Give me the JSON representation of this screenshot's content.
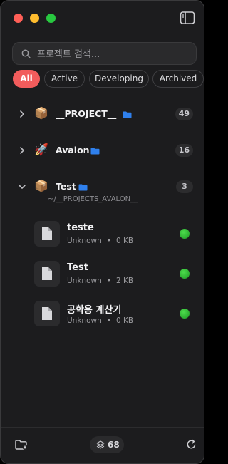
{
  "search": {
    "placeholder": "프로젝트 검색..."
  },
  "filters": [
    {
      "label": "All"
    },
    {
      "label": "Active"
    },
    {
      "label": "Developing"
    },
    {
      "label": "Archived"
    }
  ],
  "projects": [
    {
      "emoji": "📦",
      "name": "__PROJECT__",
      "count": "49",
      "expanded": false
    },
    {
      "emoji": "🚀",
      "name": "Avalon",
      "count": "16",
      "expanded": false
    },
    {
      "emoji": "📦",
      "name": "Test",
      "count": "3",
      "expanded": true,
      "path": "~/__PROJECTS_AVALON__"
    }
  ],
  "files": [
    {
      "name": "teste",
      "status": "Unknown",
      "size": "0 KB"
    },
    {
      "name": "Test",
      "status": "Unknown",
      "size": "2 KB"
    },
    {
      "name": "공학용 계산기",
      "status": "Unknown",
      "size": "0 KB"
    }
  ],
  "footer": {
    "total": "68"
  },
  "colors": {
    "accent": "#f25c5c",
    "folder": "#2f80ed",
    "status_ok": "#2fbf3a",
    "background": "#1c1c1e"
  }
}
